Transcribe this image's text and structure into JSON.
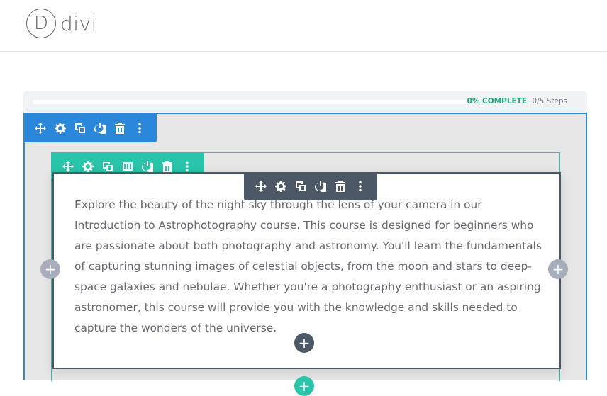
{
  "logo": {
    "mark": "D",
    "text": "divi"
  },
  "progress": {
    "percent_label": "0% COMPLETE",
    "steps_label": "0/5 Steps",
    "value": 0
  },
  "toolbars": {
    "section": [
      "move-icon",
      "gear-icon",
      "duplicate-icon",
      "power-icon",
      "trash-icon",
      "more-icon"
    ],
    "row": [
      "move-icon",
      "gear-icon",
      "duplicate-icon",
      "columns-icon",
      "power-icon",
      "trash-icon",
      "more-icon"
    ],
    "module": [
      "move-icon",
      "gear-icon",
      "duplicate-icon",
      "power-icon",
      "trash-icon",
      "more-icon"
    ]
  },
  "module": {
    "text": "Explore the beauty of the night sky through the lens of your camera in our Introduction to Astrophotography course. This course is designed for beginners who are passionate about both photography and astronomy. You'll learn the fundamentals of capturing stunning images of celestial objects, from the moon and stars to deep-space galaxies and nebulae. Whether you're a photography enthusiast or an aspiring astronomer, this course will provide you with the knowledge and skills needed to capture the wonders of the universe."
  },
  "add_buttons": {
    "symbol": "+"
  },
  "colors": {
    "section": "#2b87da",
    "row": "#29c4a9",
    "module": "#4c5866",
    "progress_accent": "#1fa77f"
  }
}
